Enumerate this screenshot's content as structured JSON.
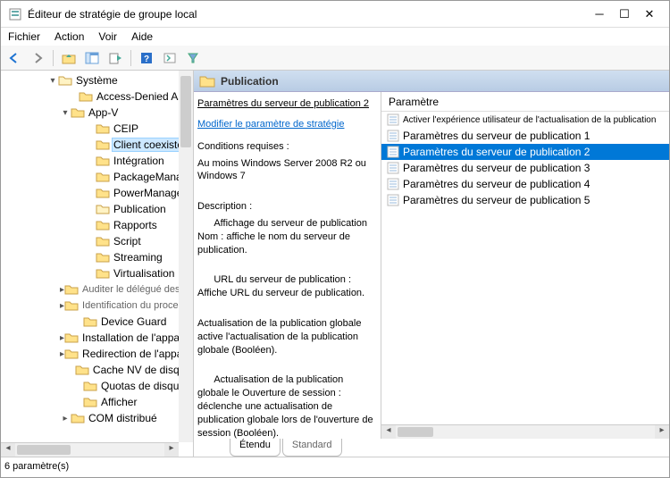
{
  "window": {
    "title": "Éditeur de stratégie de groupe local"
  },
  "menu": {
    "file": "Fichier",
    "action": "Action",
    "view": "Voir",
    "help": "Aide"
  },
  "tree": {
    "root": "Système",
    "items": [
      {
        "label": "Access-Denied Assi",
        "indent": 76,
        "expander": ""
      },
      {
        "label": "App-V",
        "indent": 62,
        "expander": "▾"
      },
      {
        "label": "CEIP",
        "indent": 90,
        "expander": ""
      },
      {
        "label": "Client coexisté",
        "indent": 90,
        "expander": "",
        "selected": true
      },
      {
        "label": "Intégration",
        "indent": 90,
        "expander": ""
      },
      {
        "label": "PackageManag",
        "indent": 90,
        "expander": ""
      },
      {
        "label": "PowerManagen",
        "indent": 90,
        "expander": ""
      },
      {
        "label": "Publication",
        "indent": 90,
        "expander": "",
        "open": true
      },
      {
        "label": "Rapports",
        "indent": 90,
        "expander": ""
      },
      {
        "label": "Script",
        "indent": 90,
        "expander": ""
      },
      {
        "label": "Streaming",
        "indent": 90,
        "expander": ""
      },
      {
        "label": "Virtualisation",
        "indent": 90,
        "expander": ""
      },
      {
        "label": "Auditer le délégué des informations",
        "indent": 62,
        "expander": "▸",
        "grey": true
      },
      {
        "label": "Identification du processus de capture",
        "indent": 62,
        "expander": "▸",
        "grey": true
      },
      {
        "label": "Device Guard",
        "indent": 76,
        "expander": ""
      },
      {
        "label": "Installation de l'appareil",
        "indent": 62,
        "expander": "▸"
      },
      {
        "label": "Redirection de l'appareil",
        "indent": 62,
        "expander": "▸"
      },
      {
        "label": "Cache NV de disque",
        "indent": 76,
        "expander": ""
      },
      {
        "label": "Quotas de disque",
        "indent": 76,
        "expander": ""
      },
      {
        "label": "Afficher",
        "indent": 76,
        "expander": ""
      },
      {
        "label": "COM distribué",
        "indent": 62,
        "expander": "▸"
      }
    ]
  },
  "content": {
    "header": "Publication",
    "setting_name": "Paramètres du serveur de publication 2",
    "edit_link": "Modifier le paramètre de stratégie",
    "req_label": "Conditions requises :",
    "req_text": "Au moins Windows Server 2008 R2 ou Windows 7",
    "desc_label": "Description :",
    "desc_1": "      Affichage du serveur de publication Nom : affiche le nom du serveur de publication.",
    "desc_2": "      URL du serveur de publication : Affiche URL du serveur de publication.",
    "desc_3": "Actualisation de la publication globale active l'actualisation de la publication globale (Booléen).",
    "desc_4": "      Actualisation de la publication globale le Ouverture de session : déclenche une actualisation de publication globale lors de l'ouverture de session (Booléen).",
    "list_header": "Paramètre",
    "list": [
      {
        "label": "Activer l'expérience utilisateur de l'actualisation de la publication",
        "selected": false
      },
      {
        "label": "Paramètres du serveur de publication 1",
        "selected": false
      },
      {
        "label": "Paramètres du serveur de publication 2",
        "selected": true
      },
      {
        "label": "Paramètres du serveur de publication 3",
        "selected": false
      },
      {
        "label": "Paramètres du serveur de publication 4",
        "selected": false
      },
      {
        "label": "Paramètres du serveur de publication 5",
        "selected": false
      }
    ]
  },
  "tabs": {
    "extended": "Étendu",
    "standard": "Standard"
  },
  "status": "6 paramètre(s)"
}
